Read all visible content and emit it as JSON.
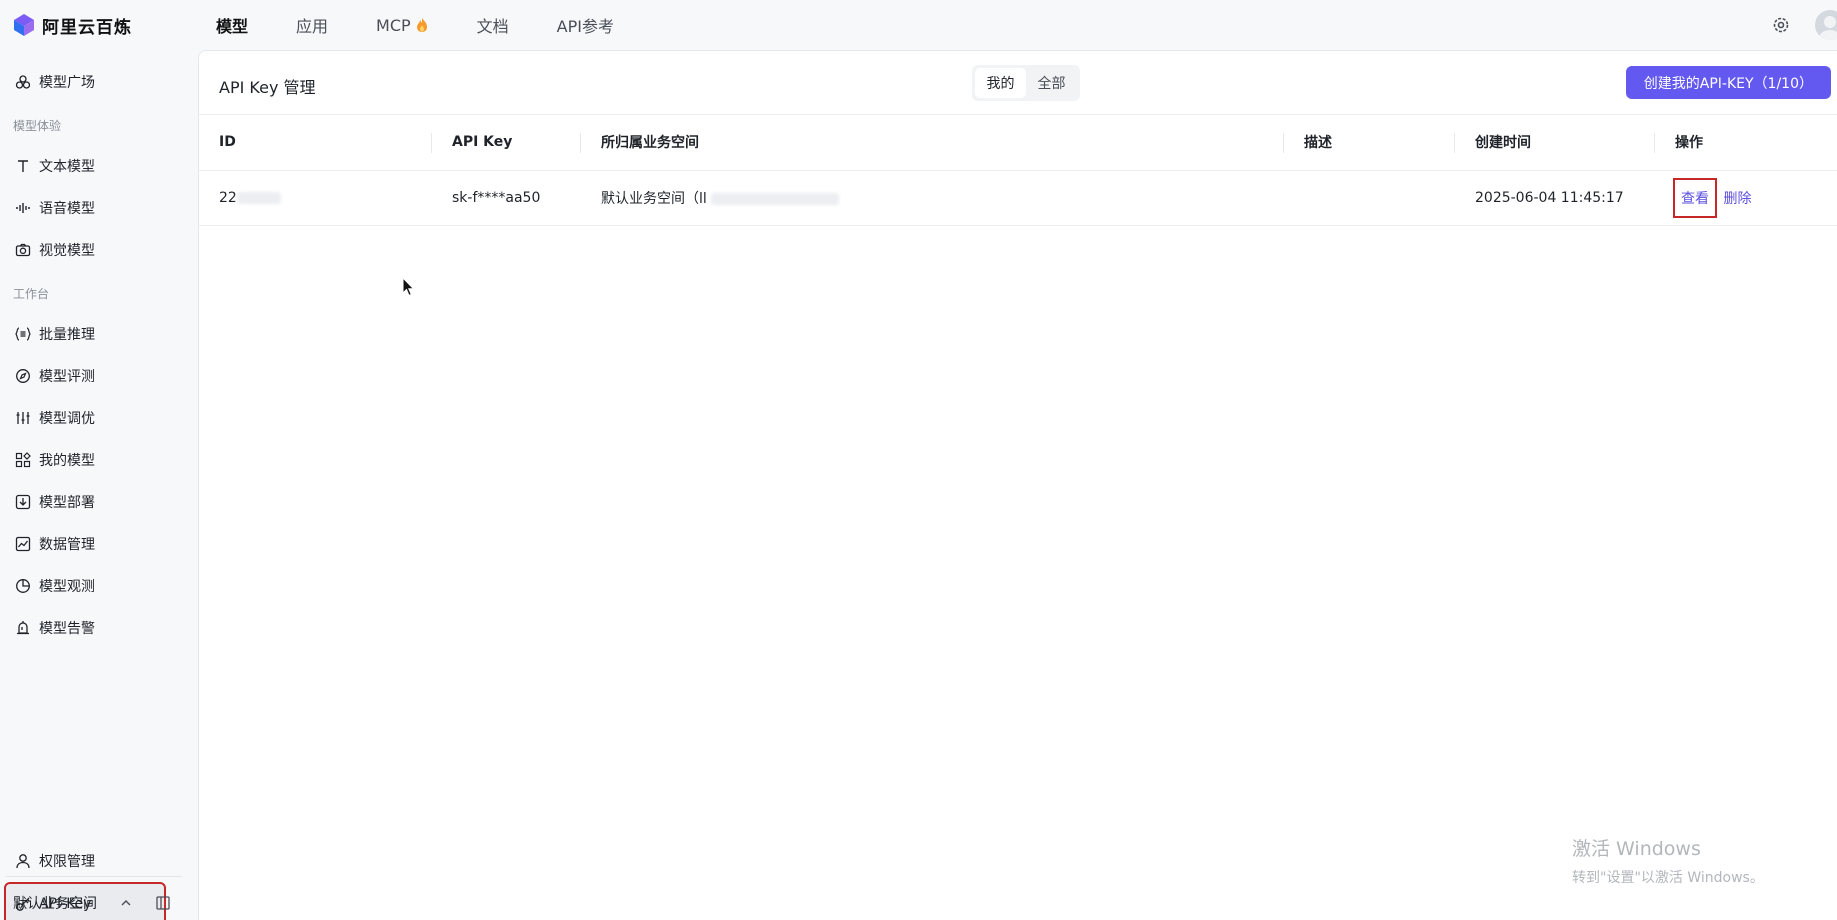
{
  "brand": {
    "name": "阿里云百炼"
  },
  "topnav": [
    {
      "label": "模型",
      "active": true
    },
    {
      "label": "应用"
    },
    {
      "label": "MCP"
    },
    {
      "label": "文档"
    },
    {
      "label": "API参考"
    }
  ],
  "sidebar": {
    "items": [
      {
        "label": "模型广场",
        "icon": "model-square-icon"
      },
      {
        "group": "模型体验"
      },
      {
        "label": "文本模型",
        "icon": "text-icon"
      },
      {
        "label": "语音模型",
        "icon": "audio-wave-icon"
      },
      {
        "label": "视觉模型",
        "icon": "camera-icon"
      },
      {
        "group": "工作台"
      },
      {
        "label": "批量推理",
        "icon": "batch-icon"
      },
      {
        "label": "模型评测",
        "icon": "compass-icon"
      },
      {
        "label": "模型调优",
        "icon": "sliders-icon"
      },
      {
        "label": "我的模型",
        "icon": "grid-icon"
      },
      {
        "label": "模型部署",
        "icon": "deploy-icon"
      },
      {
        "label": "数据管理",
        "icon": "chart-icon"
      },
      {
        "label": "模型观测",
        "icon": "pie-icon"
      },
      {
        "label": "模型告警",
        "icon": "alarm-icon"
      }
    ],
    "bottom": [
      {
        "label": "权限管理",
        "icon": "user-icon"
      },
      {
        "label": "API-Key",
        "icon": "key-icon",
        "selected": true
      }
    ],
    "workspace": "默认业务空间"
  },
  "page": {
    "title": "API Key 管理",
    "segments": [
      "我的",
      "全部"
    ],
    "active_segment": "我的",
    "create_button": "创建我的API-KEY（1/10）"
  },
  "table": {
    "headers": [
      "ID",
      "API Key",
      "所归属业务空间",
      "描述",
      "创建时间",
      "操作"
    ],
    "rows": [
      {
        "id": "22",
        "api_key": "sk-f****aa50",
        "workspace": "默认业务空间（ll",
        "description": "",
        "created": "2025-06-04 11:45:17",
        "actions": {
          "view": "查看",
          "delete": "删除"
        }
      }
    ]
  },
  "watermark": {
    "line1": "激活 Windows",
    "line2": "转到\"设置\"以激活 Windows。"
  },
  "colors": {
    "accent": "#6358f0",
    "highlight_box": "#c62828",
    "link": "#5b4fe0"
  }
}
